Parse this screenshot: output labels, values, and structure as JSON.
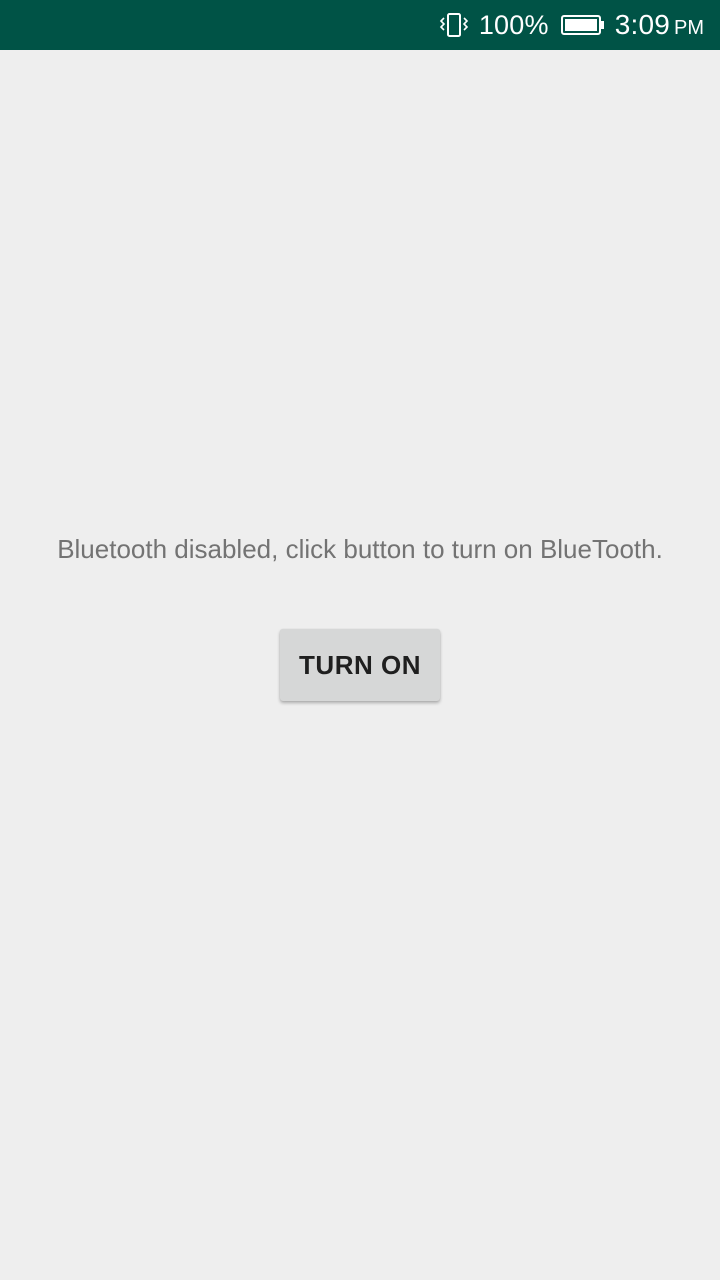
{
  "status_bar": {
    "icons": [
      "vibrate-icon",
      "battery-icon"
    ],
    "battery_percent": "100%",
    "time": "3:09",
    "ampm": "PM",
    "background_color": "#005346"
  },
  "main": {
    "message": "Bluetooth disabled, click button to turn on BlueTooth.",
    "button_label": "TURN ON"
  }
}
